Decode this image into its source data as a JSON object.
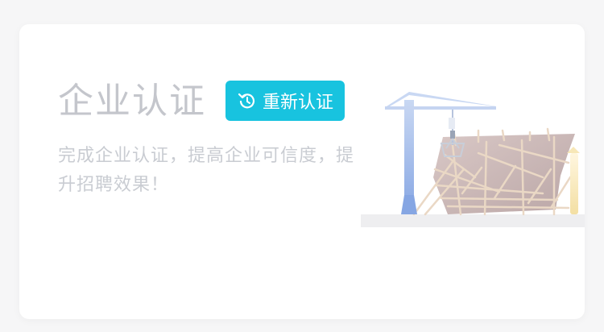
{
  "card": {
    "title": "企业认证",
    "button_label": "重新认证",
    "description": "完成企业认证，提高企业可信度，提升招聘效果！"
  },
  "icons": {
    "button_icon": "refresh-icon",
    "illustration": "construction-crane-illustration"
  },
  "colors": {
    "accent": "#18c3df",
    "title_text": "#c4c6cc",
    "description_text": "#c9ccd2",
    "card_background": "#ffffff",
    "page_background": "#f6f6f7"
  }
}
